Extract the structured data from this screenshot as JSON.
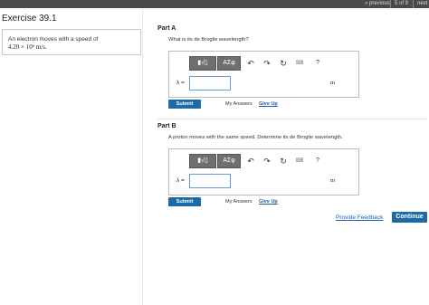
{
  "nav": {
    "previous": "« previous",
    "count": "5 of 9",
    "next": "next"
  },
  "exercise": {
    "title": "Exercise 39.1",
    "prompt_line1": "An electron moves with a speed of",
    "prompt_line2": "4.20 × 10⁶ m/s."
  },
  "toolbar": {
    "template_btn": "▮√▯",
    "symbols_btn": "ΑΣφ",
    "undo_glyph": "↶",
    "redo_glyph": "↷",
    "reset_glyph": "↻",
    "keyboard_glyph": "⌨",
    "help_glyph": "?"
  },
  "part_a": {
    "label": "Part A",
    "question": "What is its de Broglie wavelength?",
    "variable": "λ =",
    "input_value": "",
    "unit": "m",
    "submit": "Submit",
    "my_answers": "My Answers",
    "give_up": "Give Up"
  },
  "part_b": {
    "label": "Part B",
    "question": "A proton moves with the same speed. Determine its de Broglie wavelength.",
    "variable": "λ =",
    "input_value": "",
    "unit": "m",
    "submit": "Submit",
    "my_answers": "My Answers",
    "give_up": "Give Up"
  },
  "footer": {
    "feedback": "Provide Feedback",
    "continue": "Continue"
  },
  "colors": {
    "accent": "#1c6aa6",
    "link": "#1c5fa4",
    "topbar": "#4a4a4a",
    "input_border": "#6d9ad8"
  }
}
